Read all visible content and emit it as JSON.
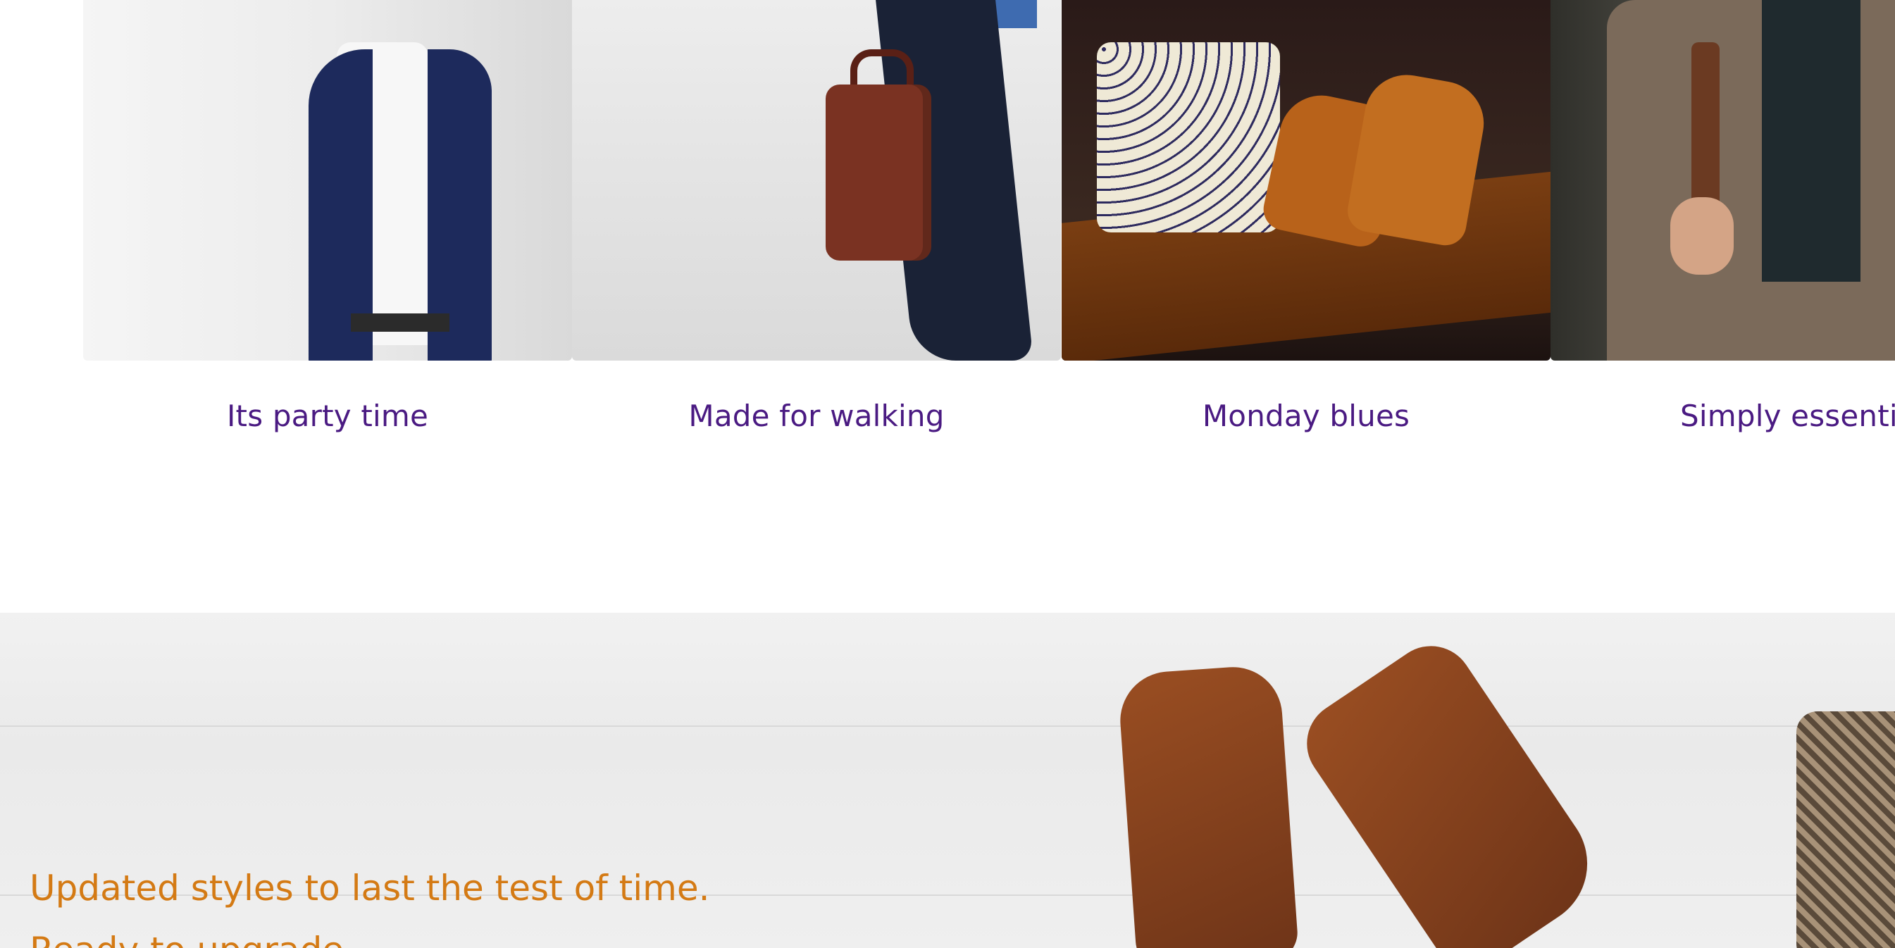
{
  "carousel": {
    "items": [
      {
        "label": "Its party time",
        "image": "suited-man-photo"
      },
      {
        "label": "Made for walking",
        "image": "briefcase-walking-photo"
      },
      {
        "label": "Monday blues",
        "image": "shirts-and-shoes-photo"
      },
      {
        "label": "Simply essentia",
        "image": "tweed-jacket-photo"
      }
    ]
  },
  "banner": {
    "headline": "Updated styles to last the test of time.",
    "subline": "Ready to upgrade..."
  },
  "colors": {
    "caption": "#4a1a82",
    "banner_text": "#d47a14"
  }
}
